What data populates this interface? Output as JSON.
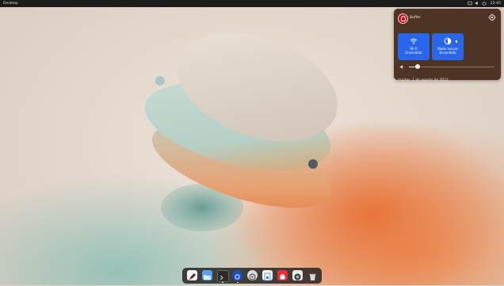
{
  "topbar": {
    "activities_label": "Desktop",
    "clock": "22:45",
    "tray_icons": [
      "network-icon",
      "sound-icon",
      "power-icon"
    ]
  },
  "quick_settings": {
    "user_name": "Buffer",
    "settings_icon": "gear-icon",
    "tiles": [
      {
        "name": "wifi",
        "title": "Wi-Fi",
        "status": "Encendido",
        "icon": "wifi-icon",
        "active": true
      },
      {
        "name": "dark-mode",
        "title": "Modo oscuro",
        "status": "Encendido",
        "icon": "dark-mode-icon",
        "active": true
      }
    ],
    "volume_level": 0.1,
    "date_text": "martes, 1 de agosto de 2023"
  },
  "dock": {
    "apps": [
      {
        "name": "launcher",
        "icon": "rocket-icon",
        "running": false
      },
      {
        "name": "files",
        "icon": "folder-icon",
        "running": false
      },
      {
        "name": "terminal",
        "icon": "terminal-icon",
        "running": true
      },
      {
        "name": "browser",
        "icon": "browser-icon",
        "running": true
      },
      {
        "name": "settings",
        "icon": "settings-icon",
        "running": false
      },
      {
        "name": "office",
        "icon": "document-icon",
        "running": false
      },
      {
        "name": "app-store",
        "icon": "store-icon",
        "running": false
      },
      {
        "name": "photos",
        "icon": "camera-icon",
        "running": false
      },
      {
        "name": "trash",
        "icon": "trash-icon",
        "running": false
      }
    ]
  },
  "colors": {
    "panel_bg": "#4e3424",
    "tile_active": "#2a66e9",
    "topbar_bg": "#1b1b1b",
    "dock_bg": "#1e1e1e"
  }
}
